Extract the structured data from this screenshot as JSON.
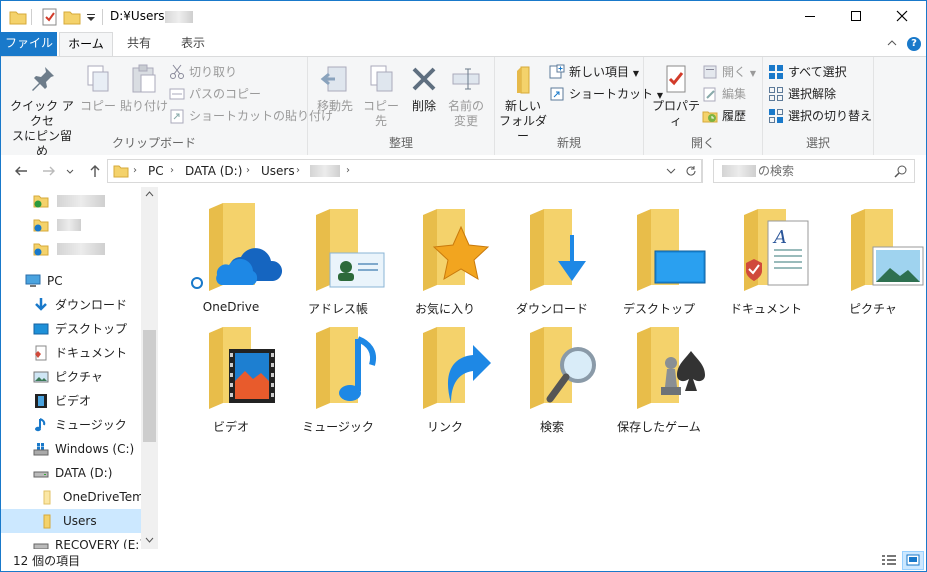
{
  "window": {
    "title_path": "D:¥Users¥",
    "minimize": "minimize",
    "maximize": "maximize",
    "close": "close"
  },
  "tabs": [
    {
      "label": "ファイル"
    },
    {
      "label": "ホーム"
    },
    {
      "label": "共有"
    },
    {
      "label": "表示"
    }
  ],
  "ribbon": {
    "clipboard": {
      "label": "クリップボード",
      "pin_line1": "クイック アクセ",
      "pin_line2": "スにピン留め",
      "copy": "コピー",
      "paste": "貼り付け",
      "cut": "切り取り",
      "copy_path": "パスのコピー",
      "paste_shortcut": "ショートカットの貼り付け"
    },
    "organize": {
      "label": "整理",
      "move_to": "移動先",
      "copy_to": "コピー先",
      "delete": "削除",
      "rename_line1": "名前の",
      "rename_line2": "変更"
    },
    "new": {
      "label": "新規",
      "new_folder_line1": "新しい",
      "new_folder_line2": "フォルダー",
      "new_item": "新しい項目",
      "shortcut": "ショートカット"
    },
    "open": {
      "label": "開く",
      "properties": "プロパティ",
      "open": "開く",
      "edit": "編集",
      "history": "履歴"
    },
    "select": {
      "label": "選択",
      "select_all": "すべて選択",
      "select_none": "選択解除",
      "invert": "選択の切り替え"
    }
  },
  "address": {
    "crumbs": [
      "PC",
      "DATA (D:)",
      "Users"
    ],
    "search_placeholder": "の検索"
  },
  "navpane": {
    "items": [
      {
        "label": "PC"
      },
      {
        "label": "ダウンロード"
      },
      {
        "label": "デスクトップ"
      },
      {
        "label": "ドキュメント"
      },
      {
        "label": "ピクチャ"
      },
      {
        "label": "ビデオ"
      },
      {
        "label": "ミュージック"
      },
      {
        "label": "Windows (C:)"
      },
      {
        "label": "DATA (D:)"
      },
      {
        "label": "OneDriveTemp"
      },
      {
        "label": "Users"
      },
      {
        "label": "RECOVERY (E:)"
      }
    ]
  },
  "folders": [
    {
      "label": "OneDrive",
      "icon": "onedrive-icon"
    },
    {
      "label": "アドレス帳",
      "icon": "contacts-icon"
    },
    {
      "label": "お気に入り",
      "icon": "favorites-star-icon"
    },
    {
      "label": "ダウンロード",
      "icon": "download-arrow-icon"
    },
    {
      "label": "デスクトップ",
      "icon": "desktop-icon"
    },
    {
      "label": "ドキュメント",
      "icon": "documents-icon"
    },
    {
      "label": "ピクチャ",
      "icon": "pictures-icon"
    },
    {
      "label": "ビデオ",
      "icon": "videos-film-icon"
    },
    {
      "label": "ミュージック",
      "icon": "music-note-icon"
    },
    {
      "label": "リンク",
      "icon": "links-arrow-icon"
    },
    {
      "label": "検索",
      "icon": "magnifier-icon"
    },
    {
      "label": "保存したゲーム",
      "icon": "chess-pieces-icon"
    }
  ],
  "status": {
    "item_count": "12 個の項目"
  },
  "colors": {
    "accent": "#1979ca",
    "folder": "#f4d26b",
    "selection": "#cce8ff"
  }
}
